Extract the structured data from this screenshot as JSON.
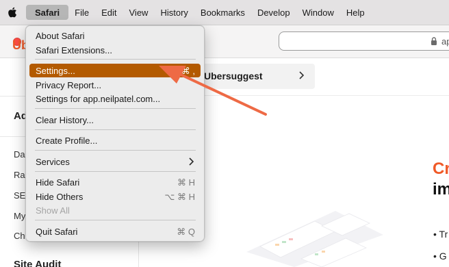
{
  "menubar": {
    "app": "Safari",
    "items": [
      "File",
      "Edit",
      "View",
      "History",
      "Bookmarks",
      "Develop",
      "Window",
      "Help"
    ]
  },
  "browser": {
    "url": "ap",
    "brand_fragment": "Ub",
    "sidebar_heading": "Ad",
    "sidebar_items": [
      "Das",
      "Ran",
      "SEO",
      "My",
      "Chr"
    ],
    "sidebar_footer": "Site Audit",
    "ubersuggest_label": "Ubersuggest",
    "headline_orange": "Cr",
    "headline_dark": "im",
    "bullets": [
      "• Tr",
      "• G"
    ]
  },
  "dropdown": {
    "items": [
      {
        "label": "About Safari",
        "shortcut": ""
      },
      {
        "label": "Safari Extensions...",
        "shortcut": ""
      },
      {
        "label": "Settings...",
        "shortcut": "⌘ ,"
      },
      {
        "label": "Privacy Report...",
        "shortcut": ""
      },
      {
        "label": "Settings for app.neilpatel.com...",
        "shortcut": ""
      },
      {
        "label": "Clear History...",
        "shortcut": ""
      },
      {
        "label": "Create Profile...",
        "shortcut": ""
      },
      {
        "label": "Services",
        "shortcut": ""
      },
      {
        "label": "Hide Safari",
        "shortcut": "⌘ H"
      },
      {
        "label": "Hide Others",
        "shortcut": "⌥ ⌘ H"
      },
      {
        "label": "Show All",
        "shortcut": ""
      },
      {
        "label": "Quit Safari",
        "shortcut": "⌘ Q"
      }
    ]
  },
  "colors": {
    "highlight": "#b35a00",
    "annotation_arrow": "#ee6a45",
    "brand_orange": "#f05a28"
  },
  "icons": [
    "apple-icon",
    "lock-icon",
    "chevron-right-icon",
    "submenu-arrow-icon"
  ]
}
